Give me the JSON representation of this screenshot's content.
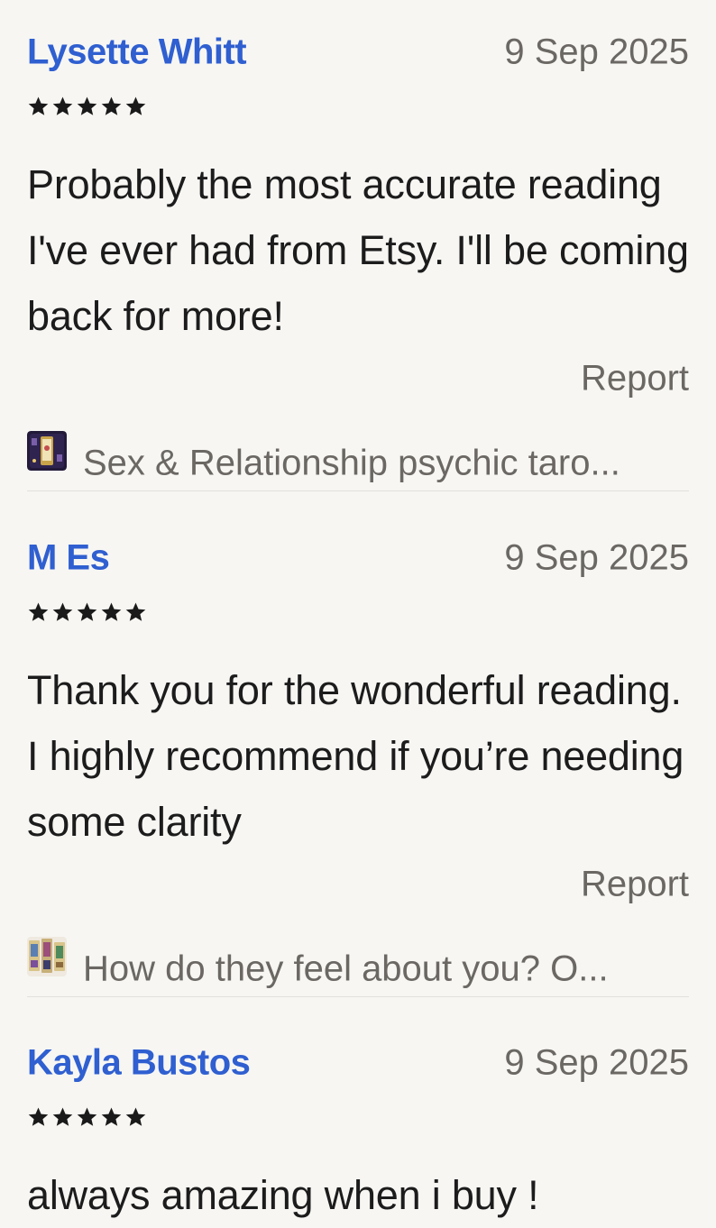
{
  "reviews": [
    {
      "name": "Lysette Whitt",
      "date": "9 Sep 2025",
      "rating": 5,
      "text": "Probably the most accurate reading I've ever had from Etsy. I'll be coming back for more!",
      "report_label": "Report",
      "product_title": "Sex & Relationship psychic taro..."
    },
    {
      "name": "M Es",
      "date": "9 Sep 2025",
      "rating": 5,
      "text": "Thank you for the wonderful reading. I highly recommend if you’re needing some clarity",
      "report_label": "Report",
      "product_title": "How do they feel about you? O..."
    },
    {
      "name": "Kayla Bustos",
      "date": "9 Sep 2025",
      "rating": 5,
      "text": "always amazing when i buy !"
    }
  ],
  "colors": {
    "background": "#f7f6f3",
    "reviewer_name": "#2f5fd0",
    "muted_text": "#6b6864",
    "body_text": "#1c1c1c",
    "star": "#1a1a1a"
  },
  "icons": {
    "star": "star-icon",
    "product_thumbnail": "tarot-card-thumbnail"
  }
}
